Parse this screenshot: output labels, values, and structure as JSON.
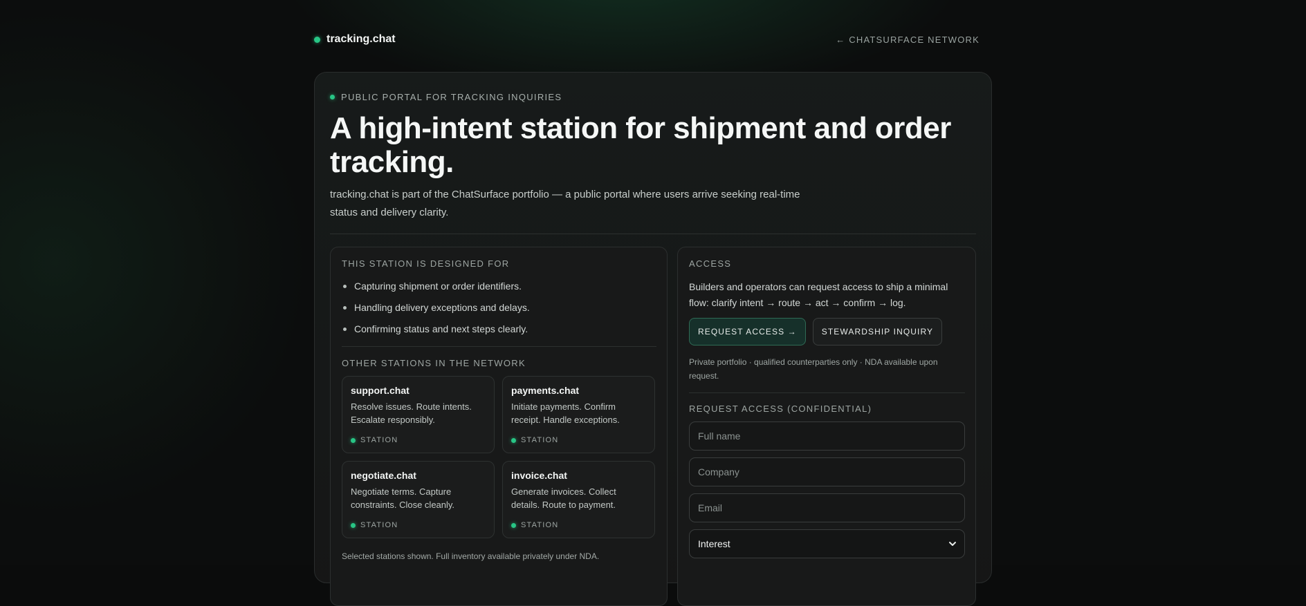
{
  "header": {
    "brand": "tracking.chat",
    "network_link": "← CHATSURFACE NETWORK"
  },
  "hero": {
    "eyebrow": "PUBLIC PORTAL FOR TRACKING INQUIRIES",
    "headline": "A high-intent station for shipment and order tracking.",
    "intro": "tracking.chat is part of the ChatSurface portfolio — a public portal where users arrive seeking real-time status and delivery clarity."
  },
  "designed_for": {
    "label": "THIS STATION IS DESIGNED FOR",
    "items": [
      "Capturing shipment or order identifiers.",
      "Handling delivery exceptions and delays.",
      "Confirming status and next steps clearly."
    ]
  },
  "network": {
    "label": "OTHER STATIONS IN THE NETWORK",
    "stations": [
      {
        "name": "support.chat",
        "desc": "Resolve issues. Route intents. Escalate responsibly.",
        "tag": "STATION"
      },
      {
        "name": "payments.chat",
        "desc": "Initiate payments. Confirm receipt. Handle exceptions.",
        "tag": "STATION"
      },
      {
        "name": "negotiate.chat",
        "desc": "Negotiate terms. Capture constraints. Close cleanly.",
        "tag": "STATION"
      },
      {
        "name": "invoice.chat",
        "desc": "Generate invoices. Collect details. Route to payment.",
        "tag": "STATION"
      }
    ],
    "footnote": "Selected stations shown. Full inventory available privately under NDA."
  },
  "access": {
    "label": "ACCESS",
    "text": "Builders and operators can request access to ship a minimal flow: clarify intent → route → act → confirm → log.",
    "request_button": "REQUEST ACCESS →",
    "stewardship_button": "STEWARDSHIP INQUIRY",
    "fine_print": "Private portfolio · qualified counterparties only · NDA available upon request.",
    "form_label": "REQUEST ACCESS (CONFIDENTIAL)",
    "placeholders": {
      "name": "Full name",
      "company": "Company",
      "email": "Email"
    },
    "interest_selected": "Interest"
  },
  "colors": {
    "accent": "#28c585",
    "background": "#0c0d0d",
    "panel": "#181919"
  },
  "icons": {
    "status": "status-dot-icon",
    "select": "chevron-down-icon"
  }
}
